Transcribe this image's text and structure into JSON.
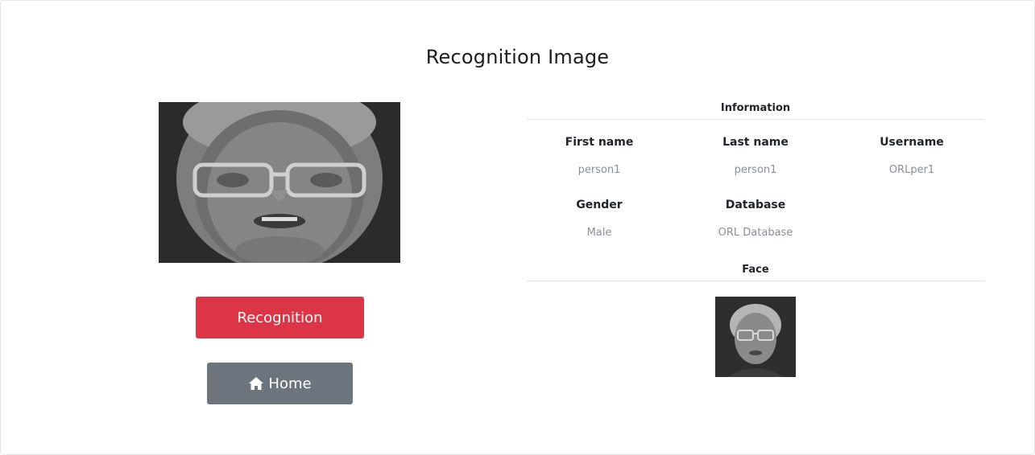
{
  "page": {
    "title": "Recognition Image"
  },
  "left": {
    "recognition_button": "Recognition",
    "home_button": "Home",
    "home_icon": "home-icon"
  },
  "info": {
    "heading": "Information",
    "fields": [
      {
        "label": "First name",
        "value": "person1"
      },
      {
        "label": "Last name",
        "value": "person1"
      },
      {
        "label": "Username",
        "value": "ORLper1"
      },
      {
        "label": "Gender",
        "value": "Male"
      },
      {
        "label": "Database",
        "value": "ORL Database"
      }
    ]
  },
  "face": {
    "heading": "Face"
  },
  "colors": {
    "danger": "#dc3545",
    "secondary": "#6c757d",
    "muted_text": "#8a8f96",
    "divider": "#dee2e6"
  }
}
